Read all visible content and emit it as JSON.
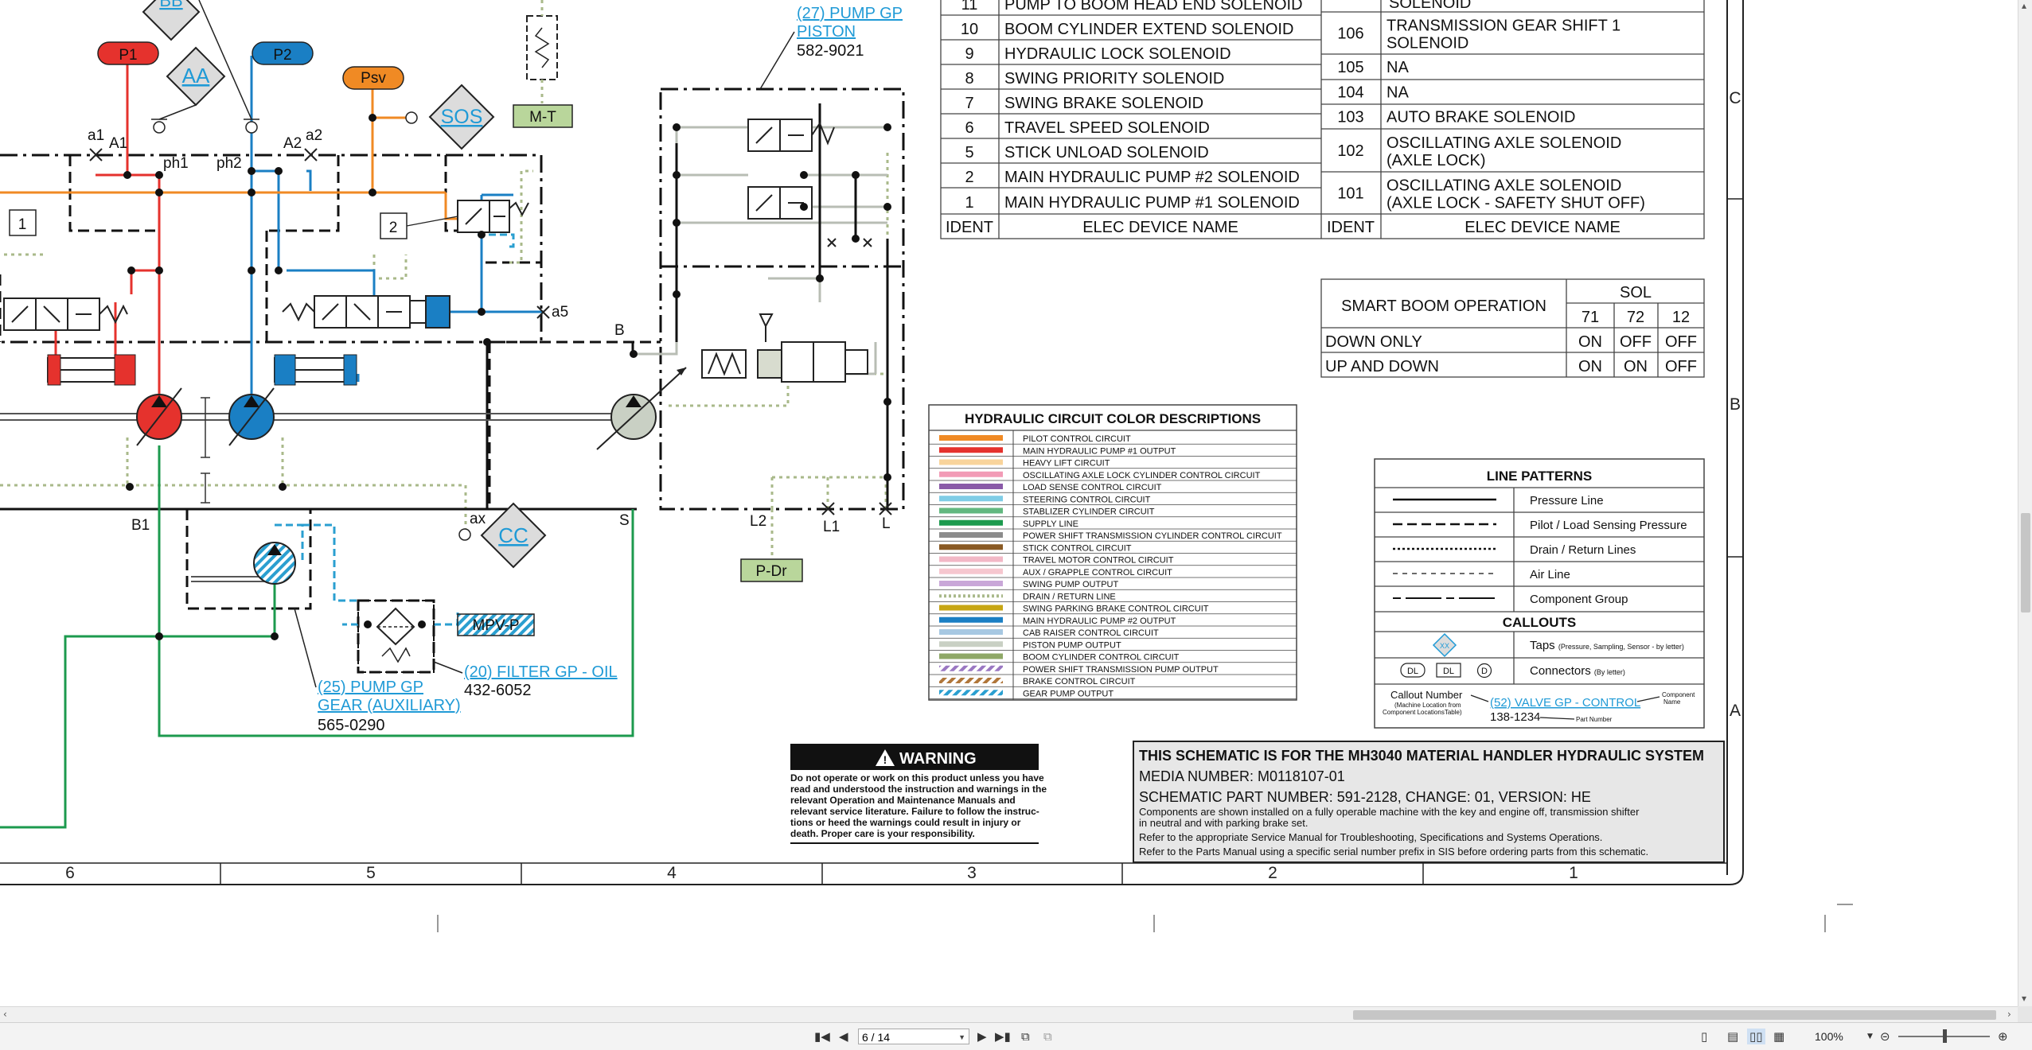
{
  "schematic": {
    "diagram_labels": {
      "bb": "BB",
      "p1": "P1",
      "p2": "P2",
      "aa": "AA",
      "psv": "Psv",
      "sos": "SOS",
      "mt": "M-T",
      "a1_lower": "a1",
      "a1_upper": "A1",
      "ph1": "ph1",
      "ph2": "ph2",
      "a2_upper": "A2",
      "a2_lower": "a2",
      "box1": "1",
      "box2": "2",
      "a5": "a5",
      "b": "B",
      "b1": "B1",
      "ax": "ax",
      "cc": "CC",
      "s": "S",
      "l2": "L2",
      "l1": "L1",
      "l": "L",
      "p_dr": "P-Dr",
      "mpv_p": "MPV-P"
    },
    "callouts": {
      "piston_pump": {
        "link_line1": "(27) PUMP GP",
        "link_line2": "PISTON",
        "part": "582-9021"
      },
      "gear_pump": {
        "link_line1": "(25) PUMP GP",
        "link_line2": "GEAR (AUXILIARY)",
        "part": "565-0290"
      },
      "filter": {
        "link": "(20) FILTER GP - OIL",
        "part": "432-6052"
      }
    },
    "device_table": {
      "header": {
        "ident": "IDENT",
        "name": "ELEC DEVICE NAME"
      },
      "left": [
        {
          "ident": "11",
          "name": "PUMP TO BOOM HEAD END SOLENOID"
        },
        {
          "ident": "10",
          "name": "BOOM CYLINDER EXTEND SOLENOID"
        },
        {
          "ident": "9",
          "name": "HYDRAULIC LOCK SOLENOID"
        },
        {
          "ident": "8",
          "name": "SWING PRIORITY SOLENOID"
        },
        {
          "ident": "7",
          "name": "SWING BRAKE SOLENOID"
        },
        {
          "ident": "6",
          "name": "TRAVEL SPEED SOLENOID"
        },
        {
          "ident": "5",
          "name": "STICK UNLOAD SOLENOID"
        },
        {
          "ident": "2",
          "name": "MAIN HYDRAULIC PUMP #2 SOLENOID"
        },
        {
          "ident": "1",
          "name": "MAIN HYDRAULIC PUMP #1 SOLENOID"
        }
      ],
      "right_top_partial": "SOLENOID",
      "right": [
        {
          "ident": "106",
          "line1": "TRANSMISSION GEAR SHIFT 1",
          "line2": "SOLENOID"
        },
        {
          "ident": "105",
          "line1": "NA",
          "line2": ""
        },
        {
          "ident": "104",
          "line1": "NA",
          "line2": ""
        },
        {
          "ident": "103",
          "line1": "AUTO BRAKE SOLENOID",
          "line2": ""
        },
        {
          "ident": "102",
          "line1": "OSCILLATING AXLE SOLENOID",
          "line2": "(AXLE LOCK)"
        },
        {
          "ident": "101",
          "line1": "OSCILLATING AXLE SOLENOID",
          "line2": "(AXLE LOCK - SAFETY SHUT OFF)"
        }
      ]
    },
    "smart_boom": {
      "title": "SMART BOOM OPERATION",
      "sol_label": "SOL",
      "columns": [
        "71",
        "72",
        "12"
      ],
      "rows": [
        {
          "label": "DOWN ONLY",
          "values": [
            "ON",
            "OFF",
            "OFF"
          ]
        },
        {
          "label": "UP AND DOWN",
          "values": [
            "ON",
            "ON",
            "OFF"
          ]
        }
      ]
    },
    "color_legend": {
      "title": "HYDRAULIC CIRCUIT COLOR DESCRIPTIONS",
      "items": [
        {
          "label": "PILOT CONTROL CIRCUIT",
          "color": "#f08a24",
          "style": "solid"
        },
        {
          "label": "MAIN HYDRAULIC PUMP #1 OUTPUT",
          "color": "#e5322d",
          "style": "solid"
        },
        {
          "label": "HEAVY LIFT CIRCUIT",
          "color": "#f9d49b",
          "style": "solid"
        },
        {
          "label": "OSCILLATING AXLE LOCK CYLINDER CONTROL CIRCUIT",
          "color": "#f29bb6",
          "style": "solid"
        },
        {
          "label": "LOAD SENSE CONTROL CIRCUIT",
          "color": "#8a5aa8",
          "style": "solid"
        },
        {
          "label": "STEERING CONTROL CIRCUIT",
          "color": "#7fcde6",
          "style": "solid"
        },
        {
          "label": "STABLIZER CYLINDER CIRCUIT",
          "color": "#62b87f",
          "style": "solid"
        },
        {
          "label": "SUPPLY LINE",
          "color": "#1c9a4e",
          "style": "solid"
        },
        {
          "label": "POWER SHIFT TRANSMISSION CYLINDER CONTROL CIRCUIT",
          "color": "#8c8c8c",
          "style": "solid"
        },
        {
          "label": "STICK CONTROL CIRCUIT",
          "color": "#8a5a24",
          "style": "solid"
        },
        {
          "label": "TRAVEL MOTOR CONTROL CIRCUIT",
          "color": "#f2b8c6",
          "style": "solid"
        },
        {
          "label": "AUX / GRAPPLE CONTROL CIRCUIT",
          "color": "#f6c7cf",
          "style": "solid"
        },
        {
          "label": "SWING PUMP OUTPUT",
          "color": "#c9a7d8",
          "style": "solid"
        },
        {
          "label": "DRAIN / RETURN LINE",
          "color": "#a9b98a",
          "style": "dotted"
        },
        {
          "label": "SWING PARKING BRAKE CONTROL CIRCUIT",
          "color": "#c7a614",
          "style": "solid"
        },
        {
          "label": "MAIN HYDRAULIC PUMP #2 OUTPUT",
          "color": "#1a7fc4",
          "style": "solid"
        },
        {
          "label": "CAB RAISER CONTROL CIRCUIT",
          "color": "#a7c8e2",
          "style": "solid"
        },
        {
          "label": "PISTON PUMP OUTPUT",
          "color": "#c9d0c4",
          "style": "solid"
        },
        {
          "label": "BOOM CYLINDER CONTROL CIRCUIT",
          "color": "#8fa867",
          "style": "solid"
        },
        {
          "label": "POWER SHIFT TRANSMISSION PUMP OUTPUT",
          "color": "#9a77c2",
          "style": "hatched"
        },
        {
          "label": "BRAKE CONTROL CIRCUIT",
          "color": "#b0763a",
          "style": "hatched"
        },
        {
          "label": "GEAR PUMP OUTPUT",
          "color": "#2a9fd0",
          "style": "hatched"
        }
      ]
    },
    "line_patterns": {
      "title": "LINE PATTERNS",
      "items": [
        {
          "label": "Pressure Line",
          "dash": "solid"
        },
        {
          "label": "Pilot / Load Sensing Pressure",
          "dash": "dashed"
        },
        {
          "label": "Drain / Return Lines",
          "dash": "dotted"
        },
        {
          "label": "Air Line",
          "dash": "fine-dashed"
        },
        {
          "label": "Component Group",
          "dash": "dash-dot"
        }
      ],
      "callouts_title": "CALLOUTS",
      "taps_label": "Taps",
      "taps_note": "(Pressure, Sampling, Sensor - by letter)",
      "taps_symbol": "XX",
      "connectors_label": "Connectors",
      "connectors_note": "(By letter)",
      "connector_symbols": [
        "DL",
        "DL",
        "D"
      ],
      "callout_number_label": "Callout Number",
      "callout_number_note1": "(Machine Location from",
      "callout_number_note2": "Component LocationsTable)",
      "callout_example_link": "(52) VALVE GP - CONTROL",
      "callout_example_part": "138-1234",
      "component_name_label1": "Component",
      "component_name_label2": "Name",
      "part_number_label": "Part Number"
    },
    "warning": {
      "title": "WARNING",
      "text_lines": [
        "Do not operate or work on this product unless you have",
        "read and understood the instruction and warnings in the",
        "relevant Operation and Maintenance Manuals and",
        "relevant service literature. Failure to follow the instruc-",
        "tions or heed the warnings could result in injury or",
        "death. Proper care is your responsibility."
      ]
    },
    "title_block": {
      "heading": "THIS SCHEMATIC IS FOR THE MH3040 MATERIAL HANDLER HYDRAULIC SYSTEM",
      "media_number": "MEDIA NUMBER: M0118107-01",
      "part_number": "SCHEMATIC PART NUMBER: 591-2128, CHANGE: 01, VERSION: HE",
      "notes": [
        "Components are shown installed on a fully operable machine with the key and engine off, transmission shifter",
        "in neutral and with parking brake set.",
        "Refer to the appropriate Service Manual for Troubleshooting, Specifications and Systems Operations.",
        "Refer to the Parts Manual using a specific serial number prefix in SIS before ordering parts from this schematic."
      ]
    },
    "zone_columns": [
      "6",
      "5",
      "4",
      "3",
      "2",
      "1"
    ],
    "zone_rows": [
      "C",
      "B",
      "A"
    ]
  },
  "viewer": {
    "page_display": "6 / 14",
    "zoom": "100%",
    "zoom_level_fraction": 0.5,
    "nav_icons": [
      "first-page-icon",
      "prev-page-icon",
      "next-page-icon",
      "last-page-icon"
    ],
    "view_icons": [
      "single-page-icon",
      "continuous-icon",
      "two-page-icon",
      "two-page-continuous-icon"
    ]
  }
}
